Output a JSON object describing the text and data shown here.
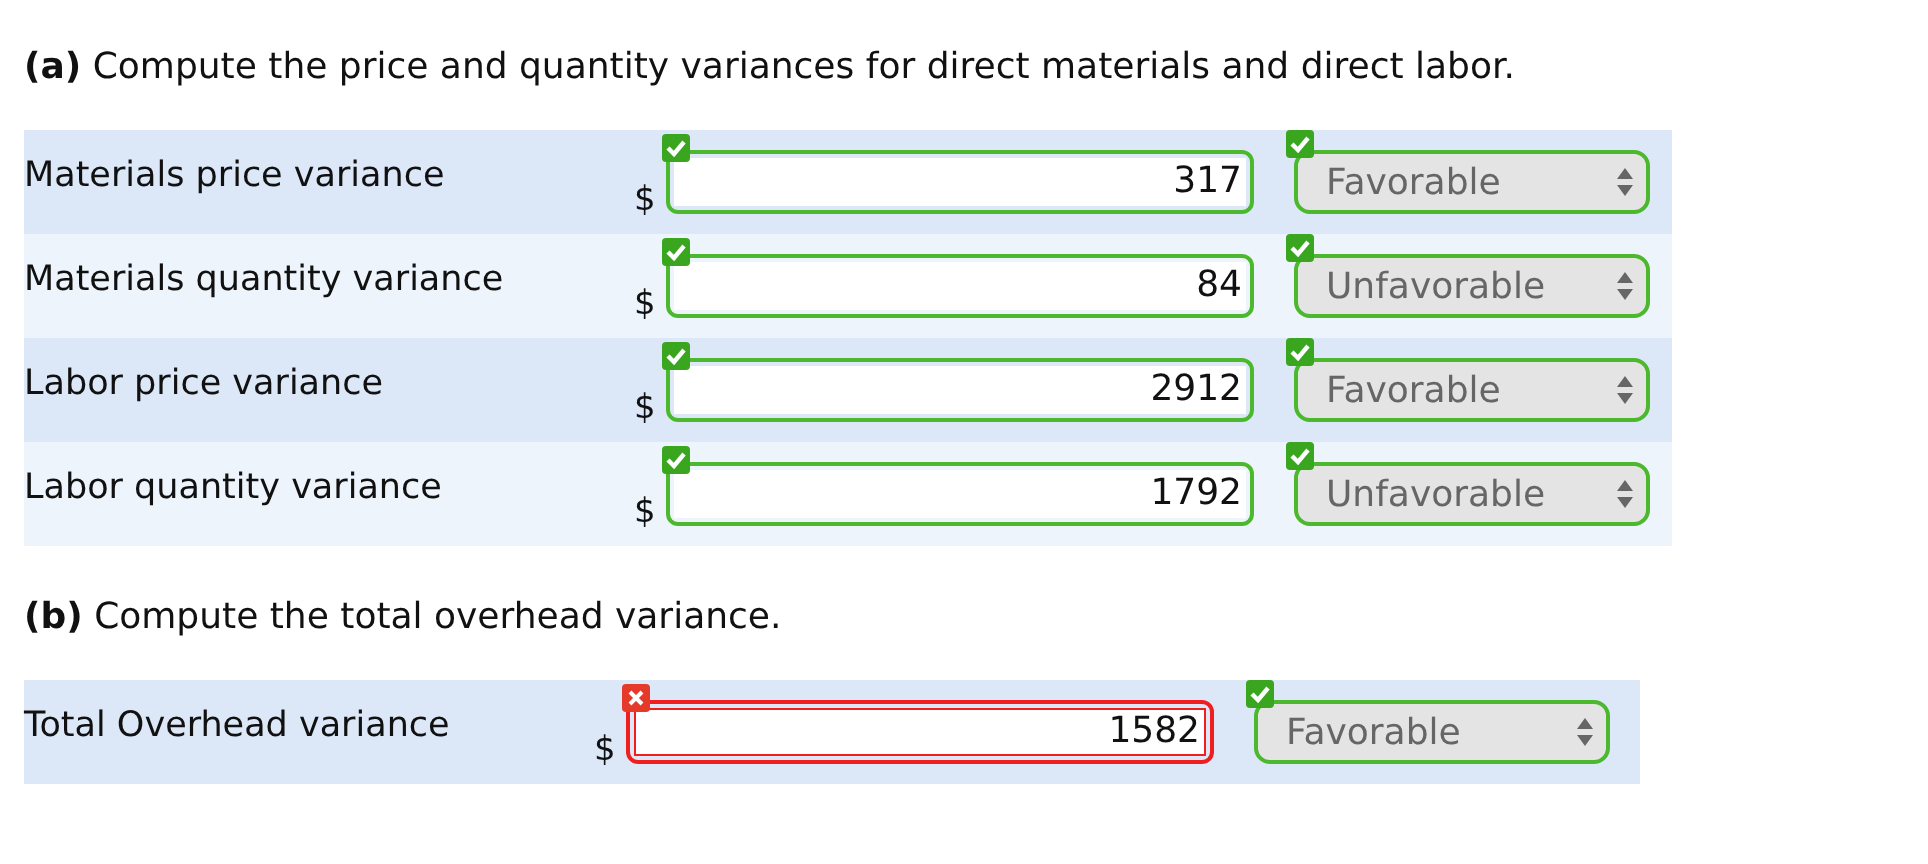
{
  "sections": [
    {
      "heading": "**(a)** Compute the price and quantity variances for direct materials and direct labor.",
      "rows": [
        {
          "label": "Materials price variance",
          "currency": "$",
          "amount": "317",
          "amount_correct": true,
          "choice": "Favorable",
          "choice_correct": true
        },
        {
          "label": "Materials quantity variance",
          "currency": "$",
          "amount": "84",
          "amount_correct": true,
          "choice": "Unfavorable",
          "choice_correct": true
        },
        {
          "label": "Labor price variance",
          "currency": "$",
          "amount": "2912",
          "amount_correct": true,
          "choice": "Favorable",
          "choice_correct": true
        },
        {
          "label": "Labor quantity variance",
          "currency": "$",
          "amount": "1792",
          "amount_correct": true,
          "choice": "Unfavorable",
          "choice_correct": true
        }
      ]
    },
    {
      "heading": "**(b)** Compute the total overhead variance.",
      "rows": [
        {
          "label": "Total Overhead variance",
          "currency": "$",
          "amount": "1582",
          "amount_correct": false,
          "choice": "Favorable",
          "choice_correct": true
        }
      ]
    }
  ]
}
